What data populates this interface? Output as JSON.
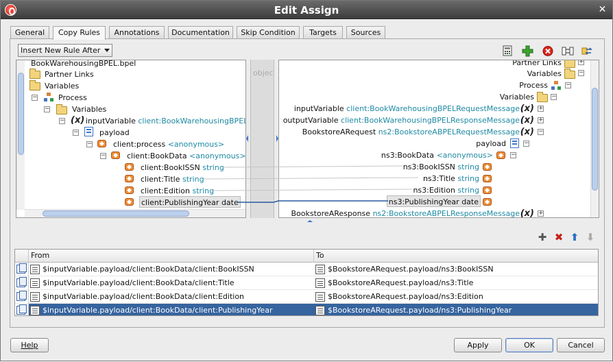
{
  "window": {
    "title": "Edit Assign"
  },
  "tabs": [
    "General",
    "Copy Rules",
    "Annotations",
    "Documentation",
    "Skip Condition",
    "Targets",
    "Sources"
  ],
  "active_tab": "Copy Rules",
  "insert_dropdown": {
    "value": "Insert New Rule After"
  },
  "source_tree": {
    "root": "BookWarehousingBPEL.bpel",
    "partner_links": "Partner Links",
    "variables": "Variables",
    "process": "Process",
    "process_variables": "Variables",
    "input_variable": {
      "name": "inputVariable",
      "type": "client:BookWarehousingBPELR"
    },
    "payload": "payload",
    "process_element": {
      "name": "client:process",
      "type": "<anonymous>"
    },
    "book_data": {
      "name": "client:BookData",
      "type": "<anonymous>"
    },
    "fields": [
      {
        "name": "client:BookISSN",
        "type": "string"
      },
      {
        "name": "client:Title",
        "type": "string"
      },
      {
        "name": "client:Edition",
        "type": "string"
      },
      {
        "name": "client:PublishingYear",
        "type": "date"
      }
    ]
  },
  "middle_label": "objec",
  "target_tree": {
    "partner_links": "Partner Links",
    "variables": "Variables",
    "process": "Process",
    "process_variables": "Variables",
    "input_variable": {
      "name": "inputVariable",
      "type": "client:BookWarehousingBPELRequestMessage"
    },
    "output_variable": {
      "name": "outputVariable",
      "type": "client:BookWarehousingBPELResponseMessage"
    },
    "request": {
      "name": "BookstoreARequest",
      "type": "ns2:BookstoreABPELRequestMessage"
    },
    "payload": "payload",
    "book_data": {
      "name": "ns3:BookData",
      "type": "<anonymous>"
    },
    "fields": [
      {
        "name": "ns3:BookISSN",
        "type": "string"
      },
      {
        "name": "ns3:Title",
        "type": "string"
      },
      {
        "name": "ns3:Edition",
        "type": "string"
      },
      {
        "name": "ns3:PublishingYear",
        "type": "date"
      }
    ],
    "response": {
      "name": "BookstoreAResponse",
      "type": "ns2:BookstoreABPELResponseMessage"
    }
  },
  "rules_table": {
    "headers": {
      "from": "From",
      "to": "To"
    },
    "rows": [
      {
        "from": "$inputVariable.payload/client:BookData/client:BookISSN",
        "to": "$BookstoreARequest.payload/ns3:BookISSN"
      },
      {
        "from": "$inputVariable.payload/client:BookData/client:Title",
        "to": "$BookstoreARequest.payload/ns3:Title"
      },
      {
        "from": "$inputVariable.payload/client:BookData/client:Edition",
        "to": "$BookstoreARequest.payload/ns3:Edition"
      },
      {
        "from": "$inputVariable.payload/client:BookData/client:PublishingYear",
        "to": "$BookstoreARequest.payload/ns3:PublishingYear"
      }
    ],
    "selected_row": 3
  },
  "buttons": {
    "help": "Help",
    "apply": "Apply",
    "ok": "OK",
    "cancel": "Cancel"
  },
  "colors": {
    "type_text": "#1e8aa3",
    "selection": "#36649e",
    "titlebar": "#4a4a4a",
    "link_line": "#2a5aa0"
  }
}
